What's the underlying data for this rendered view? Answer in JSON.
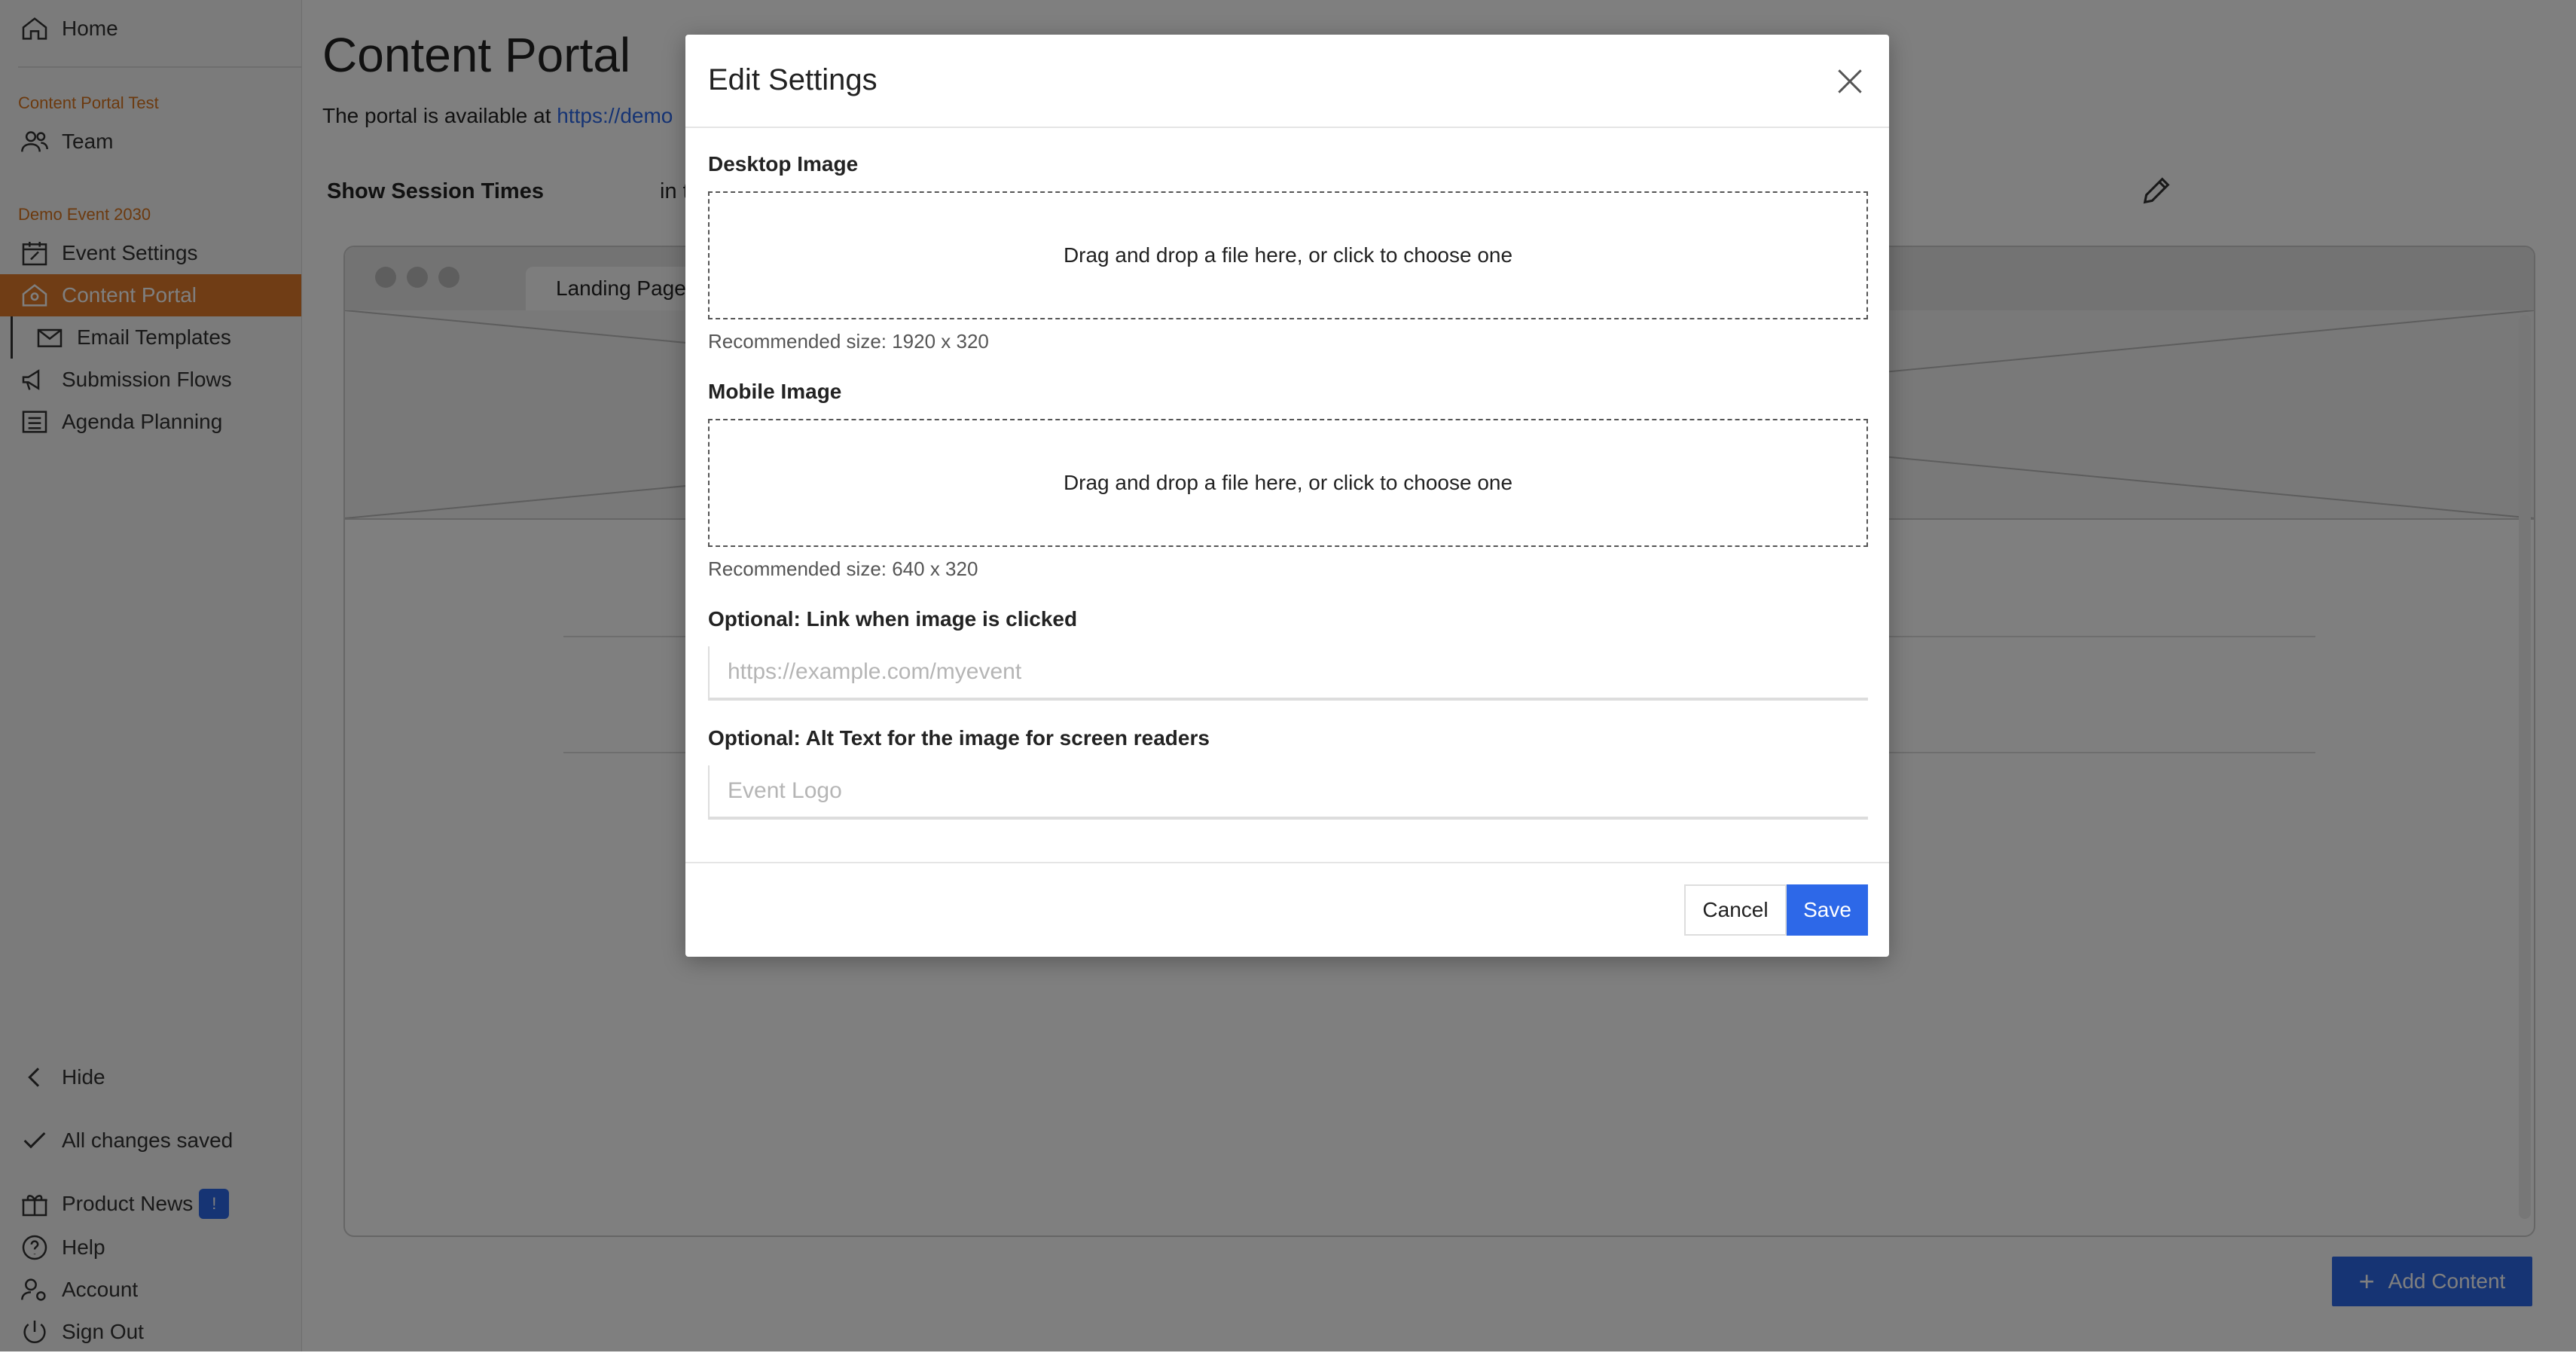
{
  "sidebar": {
    "home_label": "Home",
    "section1": "Content Portal Test",
    "team_label": "Team",
    "section2": "Demo Event 2030",
    "items": [
      {
        "label": "Event Settings"
      },
      {
        "label": "Content Portal"
      },
      {
        "label": "Email Templates"
      },
      {
        "label": "Submission Flows"
      },
      {
        "label": "Agenda Planning"
      }
    ],
    "hide_label": "Hide",
    "saved_label": "All changes saved",
    "product_news_label": "Product News",
    "product_news_badge": "!",
    "help_label": "Help",
    "account_label": "Account",
    "signout_label": "Sign Out",
    "accent_color": "#e07a2a"
  },
  "main": {
    "title": "Content Portal",
    "portal_text": "The portal is available at ",
    "portal_link": "https://demo",
    "session_label": "Show Session Times",
    "session_suffix": "in t",
    "browser_tab": "Landing Page",
    "add_content_label": "Add Content"
  },
  "modal": {
    "title": "Edit Settings",
    "desktop_label": "Desktop Image",
    "desktop_drop": "Drag and drop a file here, or click to choose one",
    "desktop_hint": "Recommended size: 1920 x 320",
    "mobile_label": "Mobile Image",
    "mobile_drop": "Drag and drop a file here, or click to choose one",
    "mobile_hint": "Recommended size: 640 x 320",
    "link_label": "Optional: Link when image is clicked",
    "link_placeholder": "https://example.com/myevent",
    "alt_label": "Optional: Alt Text for the image for screen readers",
    "alt_placeholder": "Event Logo",
    "cancel_label": "Cancel",
    "save_label": "Save",
    "primary_color": "#2d68e8"
  }
}
